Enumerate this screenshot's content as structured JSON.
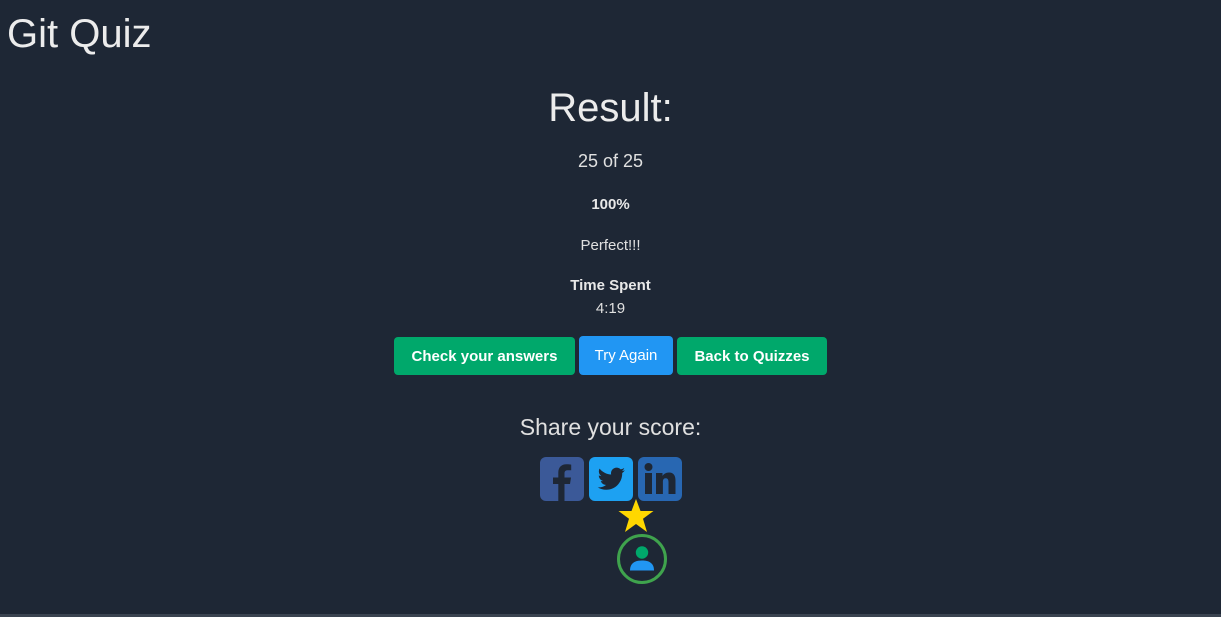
{
  "app": {
    "title": "Git Quiz"
  },
  "result": {
    "heading": "Result:",
    "score": "25 of 25",
    "percent": "100%",
    "message": "Perfect!!!",
    "time_label": "Time Spent",
    "time_value": "4:19"
  },
  "actions": {
    "check_answers": "Check your answers",
    "try_again": "Try Again",
    "back_to_quizzes": "Back to Quizzes"
  },
  "share": {
    "label": "Share your score:",
    "icons": [
      "facebook-icon",
      "twitter-icon",
      "linkedin-icon"
    ]
  },
  "colors": {
    "background": "#1e2735",
    "green_button": "#00a86b",
    "blue_button": "#2196f3",
    "facebook": "#3b5998",
    "twitter": "#1da1f2",
    "linkedin": "#2867b2",
    "star": "#ffd700",
    "avatar_ring": "#3fa34d"
  }
}
